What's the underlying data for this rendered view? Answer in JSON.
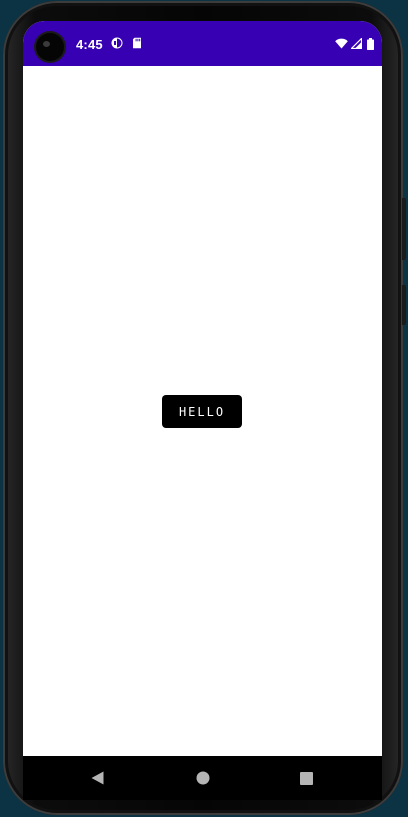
{
  "status_bar": {
    "time": "4:45",
    "background_color": "#3700b3",
    "notification_icons": [
      "app-notification-icon",
      "sd-card-icon"
    ],
    "system_icons": [
      "wifi-icon",
      "cellular-signal-icon",
      "battery-icon"
    ]
  },
  "main": {
    "button_label": "HELLO",
    "button_color": "#000000",
    "background_color": "#ffffff"
  },
  "navigation_bar": {
    "items": [
      "back-icon",
      "home-icon",
      "recents-icon"
    ]
  }
}
